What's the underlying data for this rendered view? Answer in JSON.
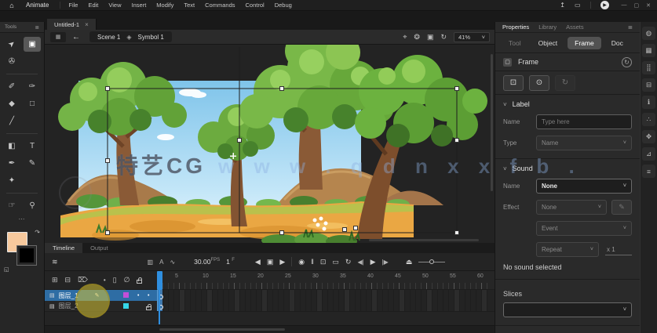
{
  "app": {
    "home_icon": "⌂",
    "name": "Animate",
    "menus": [
      "File",
      "Edit",
      "View",
      "Insert",
      "Modify",
      "Text",
      "Commands",
      "Control",
      "Debug"
    ],
    "share_icon": "↥",
    "workspace_icon": "▭",
    "play_icon": "▶",
    "min_icon": "—",
    "max_icon": "▢",
    "close_icon": "✕"
  },
  "doc_tab": {
    "title": "Untitled-1",
    "close": "×"
  },
  "tools_panel": {
    "title": "Tools",
    "menu_icon": "≣",
    "more_icon": "⋯",
    "fill_color": "#f7c99d",
    "stroke_color": "#000000",
    "swap_icon": "↷",
    "default_icon": "◱"
  },
  "tool_icons": {
    "selection": "➤",
    "free_transform": "▣",
    "lasso": "✇",
    "fluid_brush": "✐",
    "classic_brush": "✑",
    "eraser": "◆",
    "rectangle": "□",
    "line": "╱",
    "paint_bucket": "◧",
    "text": "T",
    "ink_bottle": "✒",
    "pen": "✎",
    "asset_warp": "✦",
    "hand": "☞",
    "zoom": "⚲"
  },
  "edit_bar": {
    "scene_icon": "▦",
    "back_icon": "←",
    "scene": "Scene 1",
    "symbol_icon": "◈",
    "symbol": "Symbol 1",
    "center_icon": "⌖",
    "edit_symbols_icon": "❂",
    "clip_icon": "▣",
    "rotate_icon": "↻",
    "zoom_value": "41%",
    "chevron": "˅"
  },
  "canvas": {
    "watermark_cjk": "特艺CG",
    "watermark_latin": "w w w . q d n x x f b ."
  },
  "properties": {
    "tabs": [
      "Properties",
      "Library",
      "Assets"
    ],
    "menu_icon": "≣",
    "subtabs": [
      "Tool",
      "Object",
      "Frame",
      "Doc"
    ],
    "section": {
      "icon": "▢",
      "title": "Frame",
      "help_icon": "↻"
    },
    "buttons": {
      "b1": "⊡",
      "b2": "⊙",
      "b3": "↻"
    },
    "label_section": {
      "chevron": "˅",
      "title": "Label",
      "name_label": "Name",
      "name_placeholder": "Type here",
      "type_label": "Type",
      "type_value": "Name"
    },
    "sound_section": {
      "chevron": "˅",
      "title": "Sound",
      "name_label": "Name",
      "name_value": "None",
      "effect_label": "Effect",
      "effect_value": "None",
      "edit_icon": "✎",
      "sync_value": "Event",
      "repeat_value": "Repeat",
      "repeat_suffix": "x 1",
      "status": "No sound selected"
    },
    "slices_title": "Slices",
    "dd_chevron": "˅"
  },
  "dock": [
    {
      "name": "cc-libraries",
      "glyph": "◍"
    },
    {
      "name": "keyboard-shortcuts",
      "glyph": "▦"
    },
    {
      "name": "swatches",
      "glyph": "⣿"
    },
    {
      "name": "align",
      "glyph": "⊟"
    },
    {
      "name": "info",
      "glyph": "ℹ"
    },
    {
      "name": "brush-library",
      "glyph": "∴"
    },
    {
      "name": "asset-warp",
      "glyph": "✥"
    },
    {
      "name": "history",
      "glyph": "⊿"
    },
    {
      "name": "notes",
      "glyph": "≡"
    }
  ],
  "timeline": {
    "tabs": [
      "Timeline",
      "Output"
    ],
    "layers_icon": "≋",
    "view_icons": {
      "frames": "▥",
      "advance": "A",
      "graph": "∿"
    },
    "fps_value": "30.00",
    "fps_unit": "FPS",
    "frame_value": "1",
    "frame_unit": "F",
    "prev_icon": "◀",
    "center_frame_icon": "▣",
    "next_icon": "▶",
    "onion_icon": "◉",
    "onion_outline_icon": "‖",
    "multi_frame_icon": "⊡",
    "frame_picker_icon": "▭",
    "loop_icon": "↻",
    "step_back_icon": "◀|",
    "play_icon": "▶",
    "step_fwd_icon": "|▶",
    "eject_icon": "⏏",
    "header_icons": {
      "new_layer": "⊞",
      "new_folder": "⊟",
      "delete": "⌦",
      "dot": "•",
      "outline": "▯",
      "hide": "∅"
    },
    "layers": [
      {
        "name": "图层_1",
        "color": "#c24fd8"
      },
      {
        "name": "图层_2",
        "color": "#35d6e8"
      }
    ],
    "ruler_numbers": [
      5,
      10,
      15,
      20,
      25,
      30,
      35,
      40,
      45,
      50,
      55,
      60
    ],
    "frame_count": 61,
    "accent": "#2f8fe0"
  }
}
